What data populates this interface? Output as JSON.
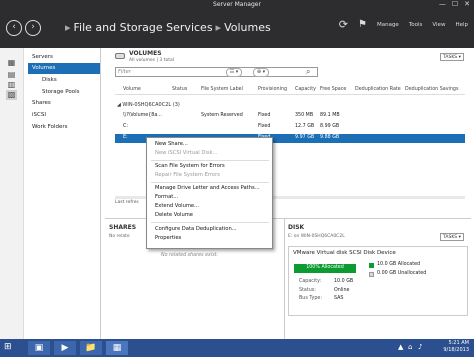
{
  "window": {
    "title": "Server Manager",
    "minimize": "—",
    "maximize": "☐",
    "close": "✕"
  },
  "header": {
    "back": "‹",
    "forward": "›",
    "breadcrumb": [
      "File and Storage Services",
      "Volumes"
    ],
    "sep": "▸",
    "refresh_icon": "⟳",
    "flag_icon": "⚑",
    "menu": [
      "Manage",
      "Tools",
      "View",
      "Help"
    ]
  },
  "rail": {
    "icons": [
      "▦",
      "▤",
      "▥",
      "▧"
    ]
  },
  "sidebar": {
    "items": [
      {
        "label": "Servers"
      },
      {
        "label": "Volumes"
      },
      {
        "label": "Disks"
      },
      {
        "label": "Storage Pools"
      },
      {
        "label": "Shares"
      },
      {
        "label": "iSCSI"
      },
      {
        "label": "Work Folders"
      }
    ]
  },
  "volumes": {
    "title": "VOLUMES",
    "subtitle": "All volumes | 3 total",
    "tasks": "TASKS ▾",
    "filter_placeholder": "Filter",
    "filter_icon": "⌕",
    "btn1": "☷ ▾",
    "btn2": "⊕ ▾",
    "columns": [
      "Volume",
      "Status",
      "File System Label",
      "Provisioning",
      "Capacity",
      "Free Space",
      "Deduplication Rate",
      "Deduplication Savings"
    ],
    "group": "◢  WIN-0SHQ6CA0C2L (3)",
    "rows": [
      {
        "volume": "\\\\?\\Volume{8a...",
        "status": "",
        "label": "System Reserved",
        "prov": "Fixed",
        "cap": "350 MB",
        "free": "89.1 MB"
      },
      {
        "volume": "C:",
        "status": "",
        "label": "",
        "prov": "Fixed",
        "cap": "12.7 GB",
        "free": "8.99 GB"
      },
      {
        "volume": "E:",
        "status": "",
        "label": "",
        "prov": "Fixed",
        "cap": "9.97 GB",
        "free": "9.88 GB"
      }
    ],
    "last_refresh": "Last refres"
  },
  "context_menu": {
    "items": [
      {
        "label": "New Share...",
        "disabled": false
      },
      {
        "label": "New iSCSI Virtual Disk...",
        "disabled": true
      },
      {
        "label": "Scan File System for Errors",
        "disabled": false
      },
      {
        "label": "Repair File System Errors",
        "disabled": true
      },
      {
        "label": "Manage Drive Letter and Access Paths...",
        "disabled": false
      },
      {
        "label": "Format...",
        "disabled": false
      },
      {
        "label": "Extend Volume...",
        "disabled": false
      },
      {
        "label": "Delete Volume",
        "disabled": false
      },
      {
        "label": "Configure Data Deduplication...",
        "disabled": false
      },
      {
        "label": "Properties",
        "disabled": false
      }
    ]
  },
  "shares": {
    "title": "SHARES",
    "subtitle": "No relate",
    "empty": "No related shares exist."
  },
  "disk": {
    "title": "DISK",
    "subtitle": "E: on WIN-0SHQ6CA0C2L",
    "tasks": "TASKS ▾",
    "name": "VMware Virtual disk SCSI Disk Device",
    "allocated_pct": 100,
    "bar_label": "100% Allocated",
    "legend": [
      {
        "text": "10.0 GB Allocated",
        "color": "#0b9b30"
      },
      {
        "text": "0.00 GB Unallocated",
        "color": "#d8d8d8"
      }
    ],
    "status_key": "Status:",
    "status_val": "Online",
    "bus_key": "Bus Type:",
    "bus_val": "SAS",
    "capacity_key": "Capacity:",
    "capacity_val": "10.0 GB"
  },
  "taskbar": {
    "start": "⊞",
    "apps": [
      "▣",
      "▶",
      "📁",
      "▦"
    ],
    "tray_icons": [
      "▲",
      "⌂",
      "♪"
    ],
    "time": "5:21 AM",
    "date": "9/18/2013"
  }
}
